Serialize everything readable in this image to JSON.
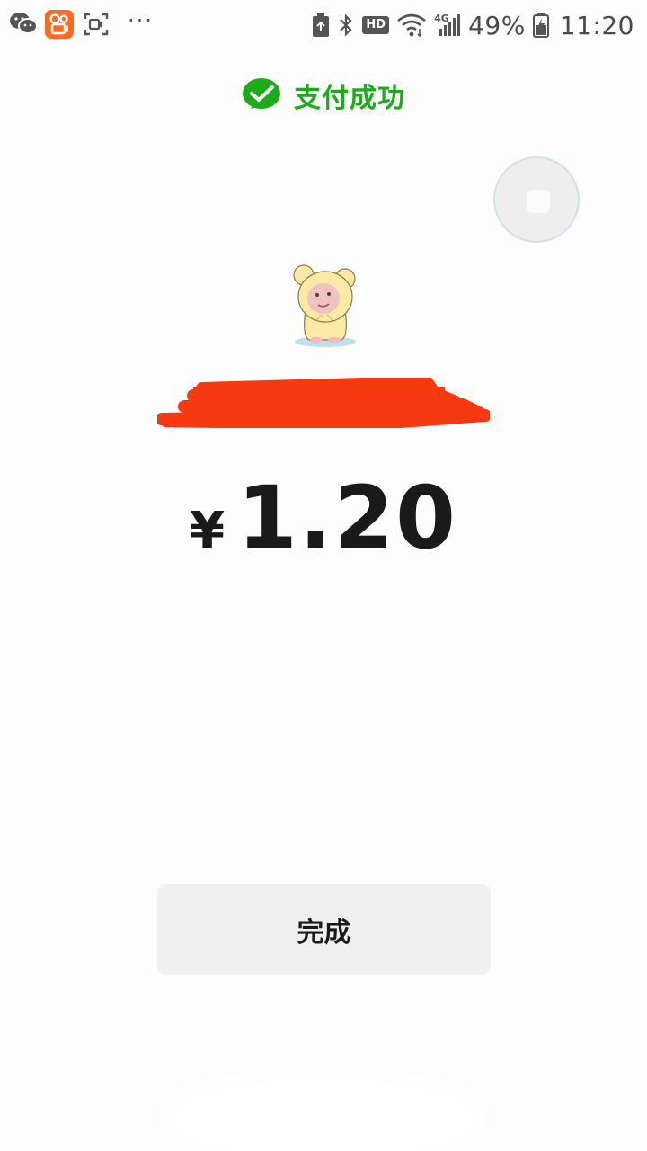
{
  "status_bar": {
    "icons_left": [
      "wechat-icon",
      "kuaishou-icon",
      "screen-record-icon",
      "more-icon"
    ],
    "more": "···",
    "hd": "HD",
    "network": "4G",
    "battery_percent": "49%",
    "time": "11:20"
  },
  "payment": {
    "title": "支付成功",
    "currency": "¥",
    "amount": "1.20",
    "done_label": "完成"
  },
  "colors": {
    "success_green": "#1aad19",
    "redaction_red": "#f53a12",
    "button_bg": "#f0f0f0"
  }
}
